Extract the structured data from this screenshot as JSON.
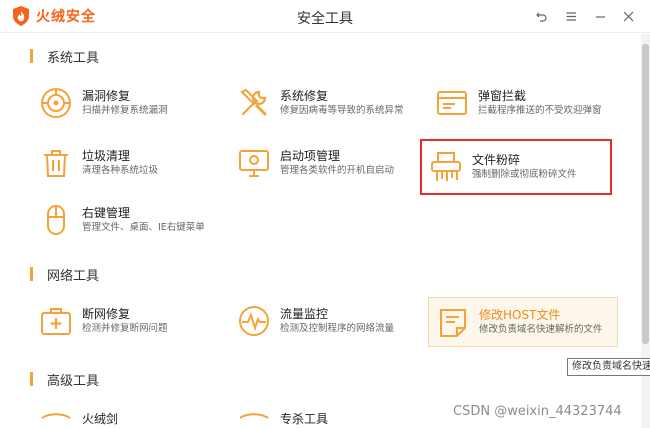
{
  "app": {
    "brand": "火绒安全",
    "title": "安全工具",
    "brand_color": "#f7631a",
    "accent_color": "#f2a33a"
  },
  "window_controls": [
    {
      "name": "back-icon"
    },
    {
      "name": "menu-icon"
    },
    {
      "name": "minimize-icon"
    },
    {
      "name": "close-icon"
    }
  ],
  "sections": {
    "system": "系统工具",
    "network": "网络工具",
    "advanced": "高级工具"
  },
  "tools": {
    "vuln_repair": {
      "name": "漏洞修复",
      "desc": "扫描并修复系统漏洞",
      "icon": "shield-scan-icon"
    },
    "system_repair": {
      "name": "系统修复",
      "desc": "修复因病毒等导致的系统异常",
      "icon": "wrench-icon"
    },
    "popup_block": {
      "name": "弹窗拦截",
      "desc": "拦截程序推送的不受欢迎弹窗",
      "icon": "popup-window-icon"
    },
    "junk_clean": {
      "name": "垃圾清理",
      "desc": "清理各种系统垃圾",
      "icon": "trash-icon"
    },
    "startup_mgr": {
      "name": "启动项管理",
      "desc": "管理各类软件的开机自启动",
      "icon": "monitor-icon"
    },
    "file_shred": {
      "name": "文件粉碎",
      "desc": "强制删除或彻底粉碎文件",
      "icon": "shredder-icon"
    },
    "context_menu": {
      "name": "右键管理",
      "desc": "管理文件、桌面、IE右键菜单",
      "icon": "mouse-icon"
    },
    "net_repair": {
      "name": "断网修复",
      "desc": "检测并修复断网问题",
      "icon": "medkit-icon"
    },
    "traffic_monitor": {
      "name": "流量监控",
      "desc": "检测及控制程序的网络流量",
      "icon": "pulse-icon"
    },
    "host_edit": {
      "name": "修改HOST文件",
      "desc": "修改负责域名快速解析的文件",
      "icon": "document-icon"
    },
    "adv_1": {
      "name": "火绒剑",
      "icon": "sword-icon"
    },
    "adv_2": {
      "name": "专杀工具",
      "icon": "tool-icon"
    }
  },
  "tooltip": "修改负责域名快速解析的文件",
  "watermark": "CSDN @weixin_44323744"
}
